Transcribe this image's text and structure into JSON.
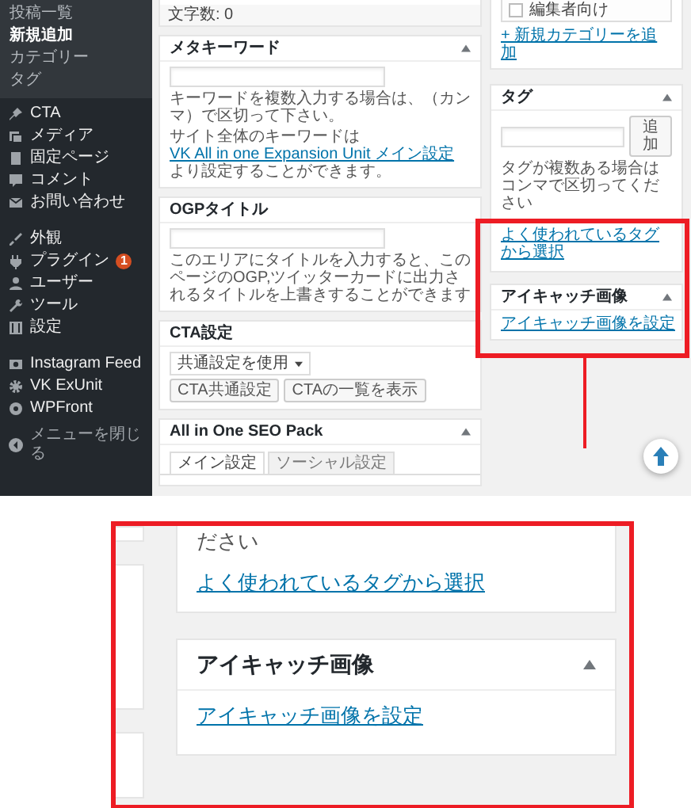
{
  "sidebar": {
    "submenu": [
      {
        "label": "投稿一覧",
        "selected": false
      },
      {
        "label": "新規追加",
        "selected": true
      },
      {
        "label": "カテゴリー",
        "selected": false
      },
      {
        "label": "タグ",
        "selected": false
      }
    ],
    "menu_groups": [
      [
        {
          "label": "CTA"
        },
        {
          "label": "メディア"
        },
        {
          "label": "固定ページ"
        },
        {
          "label": "コメント"
        },
        {
          "label": "お問い合わせ"
        }
      ],
      [
        {
          "label": "外観"
        },
        {
          "label": "プラグイン",
          "badge": "1"
        },
        {
          "label": "ユーザー"
        },
        {
          "label": "ツール"
        },
        {
          "label": "設定"
        }
      ],
      [
        {
          "label": "Instagram Feed"
        },
        {
          "label": "VK ExUnit"
        },
        {
          "label": "WPFront"
        }
      ]
    ],
    "collapse_label": "メニューを閉じる"
  },
  "editor": {
    "char_count": "文字数: 0",
    "meta_keywords": {
      "title": "メタキーワード",
      "help_1": "キーワードを複数入力する場合は、（カンマ）で区切って下さい。",
      "help_2_before": "サイト全体のキーワードは",
      "help_2_link": "VK All in one Expansion Unit メイン設定",
      "help_2_after": "より設定することができます。"
    },
    "ogp_title": {
      "title": "OGPタイトル",
      "help": "このエリアにタイトルを入力すると、このページのOGP,ツイッターカードに出力されるタイトルを上書きすることができます"
    },
    "cta": {
      "title": "CTA設定",
      "select_value": "共通設定を使用",
      "buttons": [
        "CTA共通設定",
        "CTAの一覧を表示"
      ]
    },
    "seo_pack": {
      "title": "All in One SEO Pack",
      "tabs": [
        {
          "label": "メイン設定",
          "selected": true
        },
        {
          "label": "ソーシャル設定",
          "selected": false
        }
      ]
    }
  },
  "side_panels": {
    "category_option": {
      "label": "編集者向け",
      "checked": false
    },
    "add_category_link": "+ 新規カテゴリーを追加",
    "tags": {
      "title": "タグ",
      "add_button": "追加",
      "help": "タグが複数ある場合はコンマで区切ってください",
      "popular_link": "よく使われているタグから選択"
    },
    "featured_image": {
      "title": "アイキャッチ画像",
      "link": "アイキャッチ画像を設定"
    }
  },
  "zoom_callout": {
    "tags_help_tail": "ださい",
    "popular_link": "よく使われているタグから選択",
    "featured_image": {
      "title": "アイキャッチ画像",
      "link": "アイキャッチ画像を設定"
    }
  }
}
